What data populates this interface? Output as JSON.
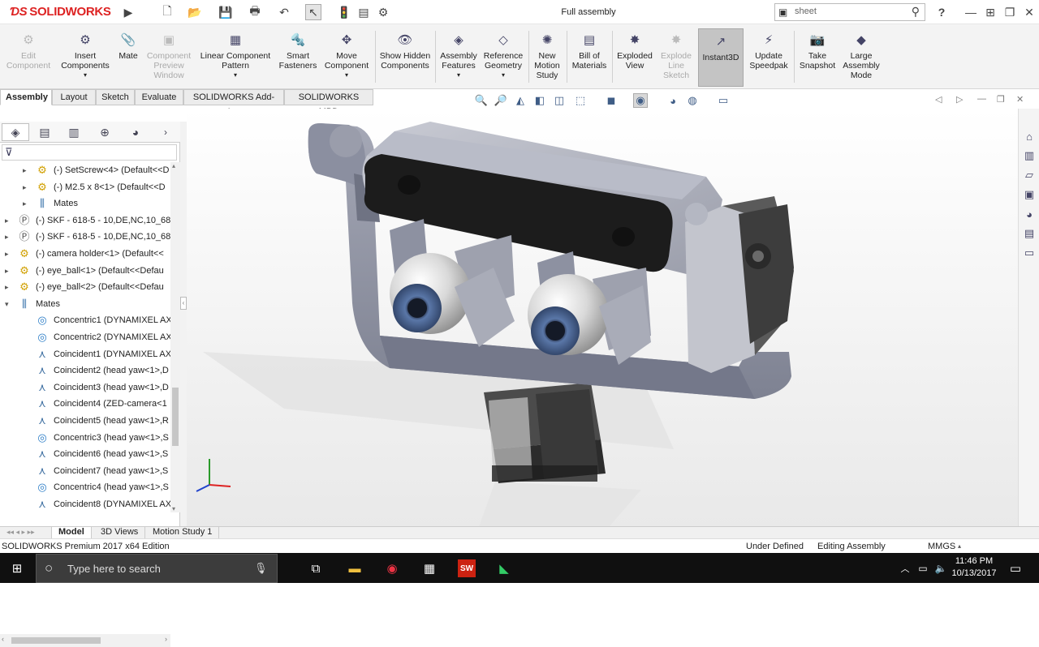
{
  "app": {
    "logo_text": "SOLIDWORKS",
    "doc_title": "Full assembly"
  },
  "search": {
    "value": "sheet"
  },
  "help": {
    "label": "?"
  },
  "ribbon": {
    "items": [
      {
        "label": "Edit Component",
        "icon": "edit-component-icon",
        "disabled": true
      },
      {
        "label": "Insert Components",
        "icon": "insert-components-icon"
      },
      {
        "label": "Mate",
        "icon": "mate-icon"
      },
      {
        "label": "Component Preview Window",
        "icon": "component-preview-icon",
        "disabled": true
      },
      {
        "label": "Linear Component Pattern",
        "icon": "linear-pattern-icon"
      },
      {
        "label": "Smart Fasteners",
        "icon": "smart-fasteners-icon"
      },
      {
        "label": "Move Component",
        "icon": "move-component-icon"
      },
      {
        "label": "Show Hidden Components",
        "icon": "show-hidden-icon"
      },
      {
        "label": "Assembly Features",
        "icon": "assembly-features-icon"
      },
      {
        "label": "Reference Geometry",
        "icon": "reference-geometry-icon"
      },
      {
        "label": "New Motion Study",
        "icon": "motion-study-icon"
      },
      {
        "label": "Bill of Materials",
        "icon": "bom-icon"
      },
      {
        "label": "Exploded View",
        "icon": "exploded-view-icon"
      },
      {
        "label": "Explode Line Sketch",
        "icon": "explode-line-icon",
        "disabled": true
      },
      {
        "label": "Instant3D",
        "icon": "instant3d-icon",
        "active": true
      },
      {
        "label": "Update Speedpak",
        "icon": "speedpak-icon"
      },
      {
        "label": "Take Snapshot",
        "icon": "snapshot-icon"
      },
      {
        "label": "Large Assembly Mode",
        "icon": "large-assembly-icon"
      }
    ]
  },
  "cm_tabs": [
    "Assembly",
    "Layout",
    "Sketch",
    "Evaluate",
    "SOLIDWORKS Add-Ins",
    "SOLIDWORKS MBD"
  ],
  "tree": [
    {
      "label": "(-) SetScrew<4> (Default<<D",
      "type": "part"
    },
    {
      "label": "(-) M2.5 x 8<1> (Default<<D",
      "type": "part"
    },
    {
      "label": "Mates",
      "type": "mate"
    },
    {
      "label": "(-) SKF - 618-5 - 10,DE,NC,10_68<",
      "type": "bolt"
    },
    {
      "label": "(-) SKF - 618-5 - 10,DE,NC,10_68<",
      "type": "bolt"
    },
    {
      "label": "(-) camera holder<1> (Default<<",
      "type": "part"
    },
    {
      "label": "(-) eye_ball<1> (Default<<Defau",
      "type": "part"
    },
    {
      "label": "(-) eye_ball<2> (Default<<Defau",
      "type": "part"
    },
    {
      "label": "Mates",
      "type": "mate"
    },
    {
      "label": "Concentric1 (DYNAMIXEL AX",
      "type": "conc"
    },
    {
      "label": "Concentric2 (DYNAMIXEL AX",
      "type": "conc"
    },
    {
      "label": "Coincident1 (DYNAMIXEL AX",
      "type": "coin"
    },
    {
      "label": "Coincident2 (head yaw<1>,D",
      "type": "coin"
    },
    {
      "label": "Coincident3 (head yaw<1>,D",
      "type": "coin"
    },
    {
      "label": "Coincident4 (ZED-camera<1",
      "type": "coin"
    },
    {
      "label": "Coincident5 (head yaw<1>,R",
      "type": "coin"
    },
    {
      "label": "Concentric3 (head yaw<1>,S",
      "type": "conc"
    },
    {
      "label": "Coincident6 (head yaw<1>,S",
      "type": "coin"
    },
    {
      "label": "Coincident7 (head yaw<1>,S",
      "type": "coin"
    },
    {
      "label": "Concentric4 (head yaw<1>,S",
      "type": "conc"
    },
    {
      "label": "Coincident8 (DYNAMIXEL AX",
      "type": "coin"
    }
  ],
  "bottom_tabs": [
    "Model",
    "3D Views",
    "Motion Study 1"
  ],
  "status": {
    "edition": "SOLIDWORKS Premium 2017 x64 Edition",
    "state": "Under Defined",
    "mode": "Editing Assembly",
    "units": "MMGS"
  },
  "taskbar": {
    "search_placeholder": "Type here to search",
    "time": "11:46 PM",
    "date": "10/13/2017"
  },
  "colors": {
    "brand": "#d22222",
    "accent": "#3f5d86"
  }
}
